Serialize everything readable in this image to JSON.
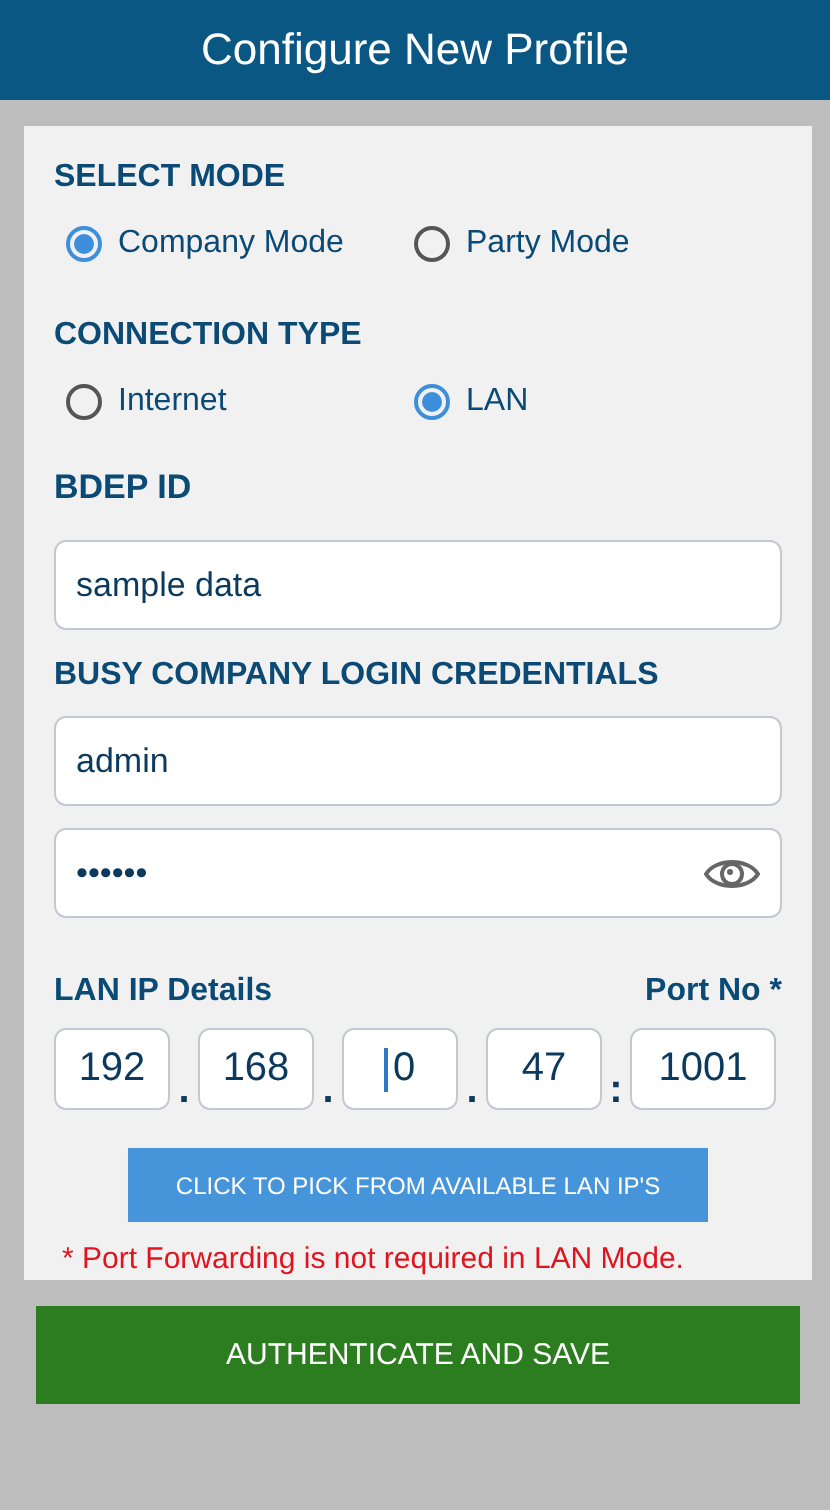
{
  "header": {
    "title": "Configure New Profile"
  },
  "select_mode": {
    "label": "SELECT MODE",
    "options": [
      {
        "label": "Company Mode",
        "selected": true
      },
      {
        "label": "Party Mode",
        "selected": false
      }
    ]
  },
  "connection_type": {
    "label": "CONNECTION TYPE",
    "options": [
      {
        "label": "Internet",
        "selected": false
      },
      {
        "label": "LAN",
        "selected": true
      }
    ]
  },
  "bdep_id": {
    "label": "BDEP ID",
    "value": "sample data"
  },
  "credentials": {
    "label": "BUSY COMPANY LOGIN CREDENTIALS",
    "username": "admin",
    "password": "••••••"
  },
  "lan_ip": {
    "label": "LAN IP Details",
    "port_label": "Port No *",
    "fields": [
      {
        "kind": "octet",
        "value": "192"
      },
      {
        "kind": "separator",
        "value": "."
      },
      {
        "kind": "octet",
        "value": "168"
      },
      {
        "kind": "separator",
        "value": "."
      },
      {
        "kind": "octet",
        "value": "0",
        "focused": true
      },
      {
        "kind": "separator",
        "value": "."
      },
      {
        "kind": "octet",
        "value": "47"
      },
      {
        "kind": "separator",
        "value": ":"
      },
      {
        "kind": "port",
        "value": "1001"
      }
    ]
  },
  "pick_button": "CLICK TO PICK FROM AVAILABLE LAN IP'S",
  "note": "* Port Forwarding is not required in LAN Mode.",
  "save_button": "AUTHENTICATE AND SAVE"
}
